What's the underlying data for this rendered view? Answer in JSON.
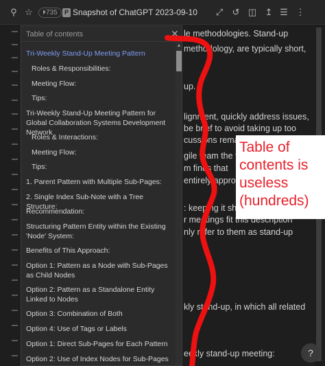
{
  "window": {
    "badge": "⏵735",
    "page_badge": "P",
    "title": "Snapshot of ChatGPT 2023-09-10"
  },
  "toc": {
    "header": "Table of contents",
    "items": [
      {
        "label": "Tri-Weekly Stand-Up Meeting Pattern",
        "level": 1,
        "active": true
      },
      {
        "label": "Roles & Responsibilities:",
        "level": 2
      },
      {
        "label": "Meeting Flow:",
        "level": 2
      },
      {
        "label": "Tips:",
        "level": 2
      },
      {
        "label": "Tri-Weekly Stand-Up Meeting Pattern for Global Collaboration Systems Development Network",
        "level": 1
      },
      {
        "label": "Roles & Interactions:",
        "level": 2
      },
      {
        "label": "Meeting Flow:",
        "level": 2
      },
      {
        "label": "Tips:",
        "level": 2
      },
      {
        "label": "1. Parent Pattern with Multiple Sub-Pages:",
        "level": 1
      },
      {
        "label": "2. Single Index Sub-Note with a Tree Structure:",
        "level": 1
      },
      {
        "label": "Recommendation:",
        "level": 1
      },
      {
        "label": "Structuring Pattern Entity within the Existing 'Node' System:",
        "level": 1
      },
      {
        "label": "Benefits of This Approach:",
        "level": 1
      },
      {
        "label": "Option 1: Pattern as a Node with Sub-Pages as Child Nodes",
        "level": 1
      },
      {
        "label": "Option 2: Pattern as a Standalone Entity Linked to Nodes",
        "level": 1
      },
      {
        "label": "Option 3: Combination of Both",
        "level": 1
      },
      {
        "label": "Option 4: Use of Tags or Labels",
        "level": 1
      },
      {
        "label": "Option 1: Direct Sub-Pages for Each Pattern",
        "level": 1
      },
      {
        "label": "Option 2: Use of Index Nodes for Sub-Pages",
        "level": 1
      }
    ]
  },
  "document_lines": [
    "le methodologies. Stand-up",
    "methodology, are typically short,",
    "up.",
    "lignment, quickly address issues,",
    "be brief to avoid taking up too",
    "cussions remain",
    "gile team the f",
    "m finds that",
    "entirely appro",
    ": keeping it sho",
    "r meetings fit this description",
    "nly refer to them as stand-up",
    "kly stand-up, in which all related",
    "eekly stand-up meeting:"
  ],
  "annotation": {
    "lines": [
      "Table of",
      "contents is",
      "useless",
      "(hundreds)"
    ],
    "color": "#e8202a"
  },
  "help_label": "?",
  "colors": {
    "accent": "#7f9cf5",
    "background": "#1e1e1e",
    "panel": "#2b2b2b"
  }
}
